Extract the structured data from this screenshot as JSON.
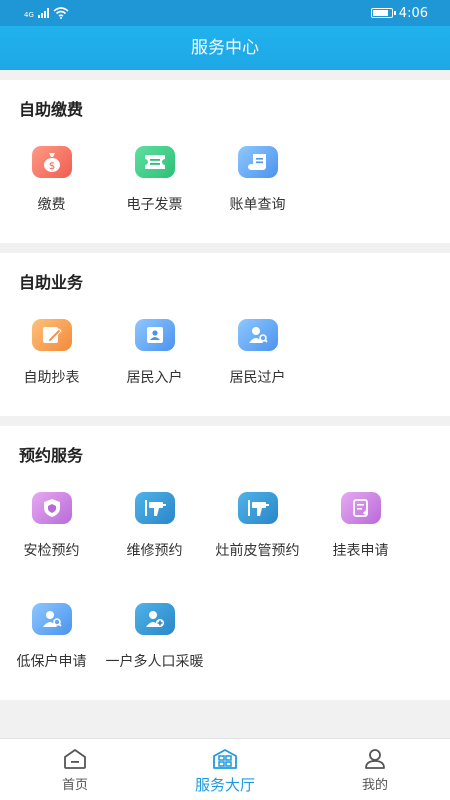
{
  "status": {
    "network": "4G",
    "time": "4:06"
  },
  "header": {
    "title": "服务中心"
  },
  "sections": [
    {
      "title": "自助缴费",
      "items": [
        {
          "label": "缴费",
          "icon": "money-bag-icon"
        },
        {
          "label": "电子发票",
          "icon": "ticket-icon"
        },
        {
          "label": "账单查询",
          "icon": "bill-scroll-icon"
        }
      ]
    },
    {
      "title": "自助业务",
      "items": [
        {
          "label": "自助抄表",
          "icon": "edit-note-icon"
        },
        {
          "label": "居民入户",
          "icon": "resident-card-icon"
        },
        {
          "label": "居民过户",
          "icon": "transfer-user-icon"
        }
      ]
    },
    {
      "title": "预约服务",
      "items": [
        {
          "label": "安检预约",
          "icon": "shield-icon"
        },
        {
          "label": "维修预约",
          "icon": "drill-tool-icon"
        },
        {
          "label": "灶前皮管预约",
          "icon": "drill-tool-icon"
        },
        {
          "label": "挂表申请",
          "icon": "meter-document-icon"
        },
        {
          "label": "低保户申请",
          "icon": "low-income-user-icon"
        },
        {
          "label": "一户多人口采暖",
          "icon": "add-user-icon"
        }
      ]
    }
  ],
  "nav": [
    {
      "label": "首页",
      "icon": "home-icon"
    },
    {
      "label": "服务大厅",
      "icon": "service-hall-icon"
    },
    {
      "label": "我的",
      "icon": "profile-icon"
    }
  ],
  "colors": {
    "primary": "#1ea7e6",
    "nav_active": "#1e9ae0"
  }
}
